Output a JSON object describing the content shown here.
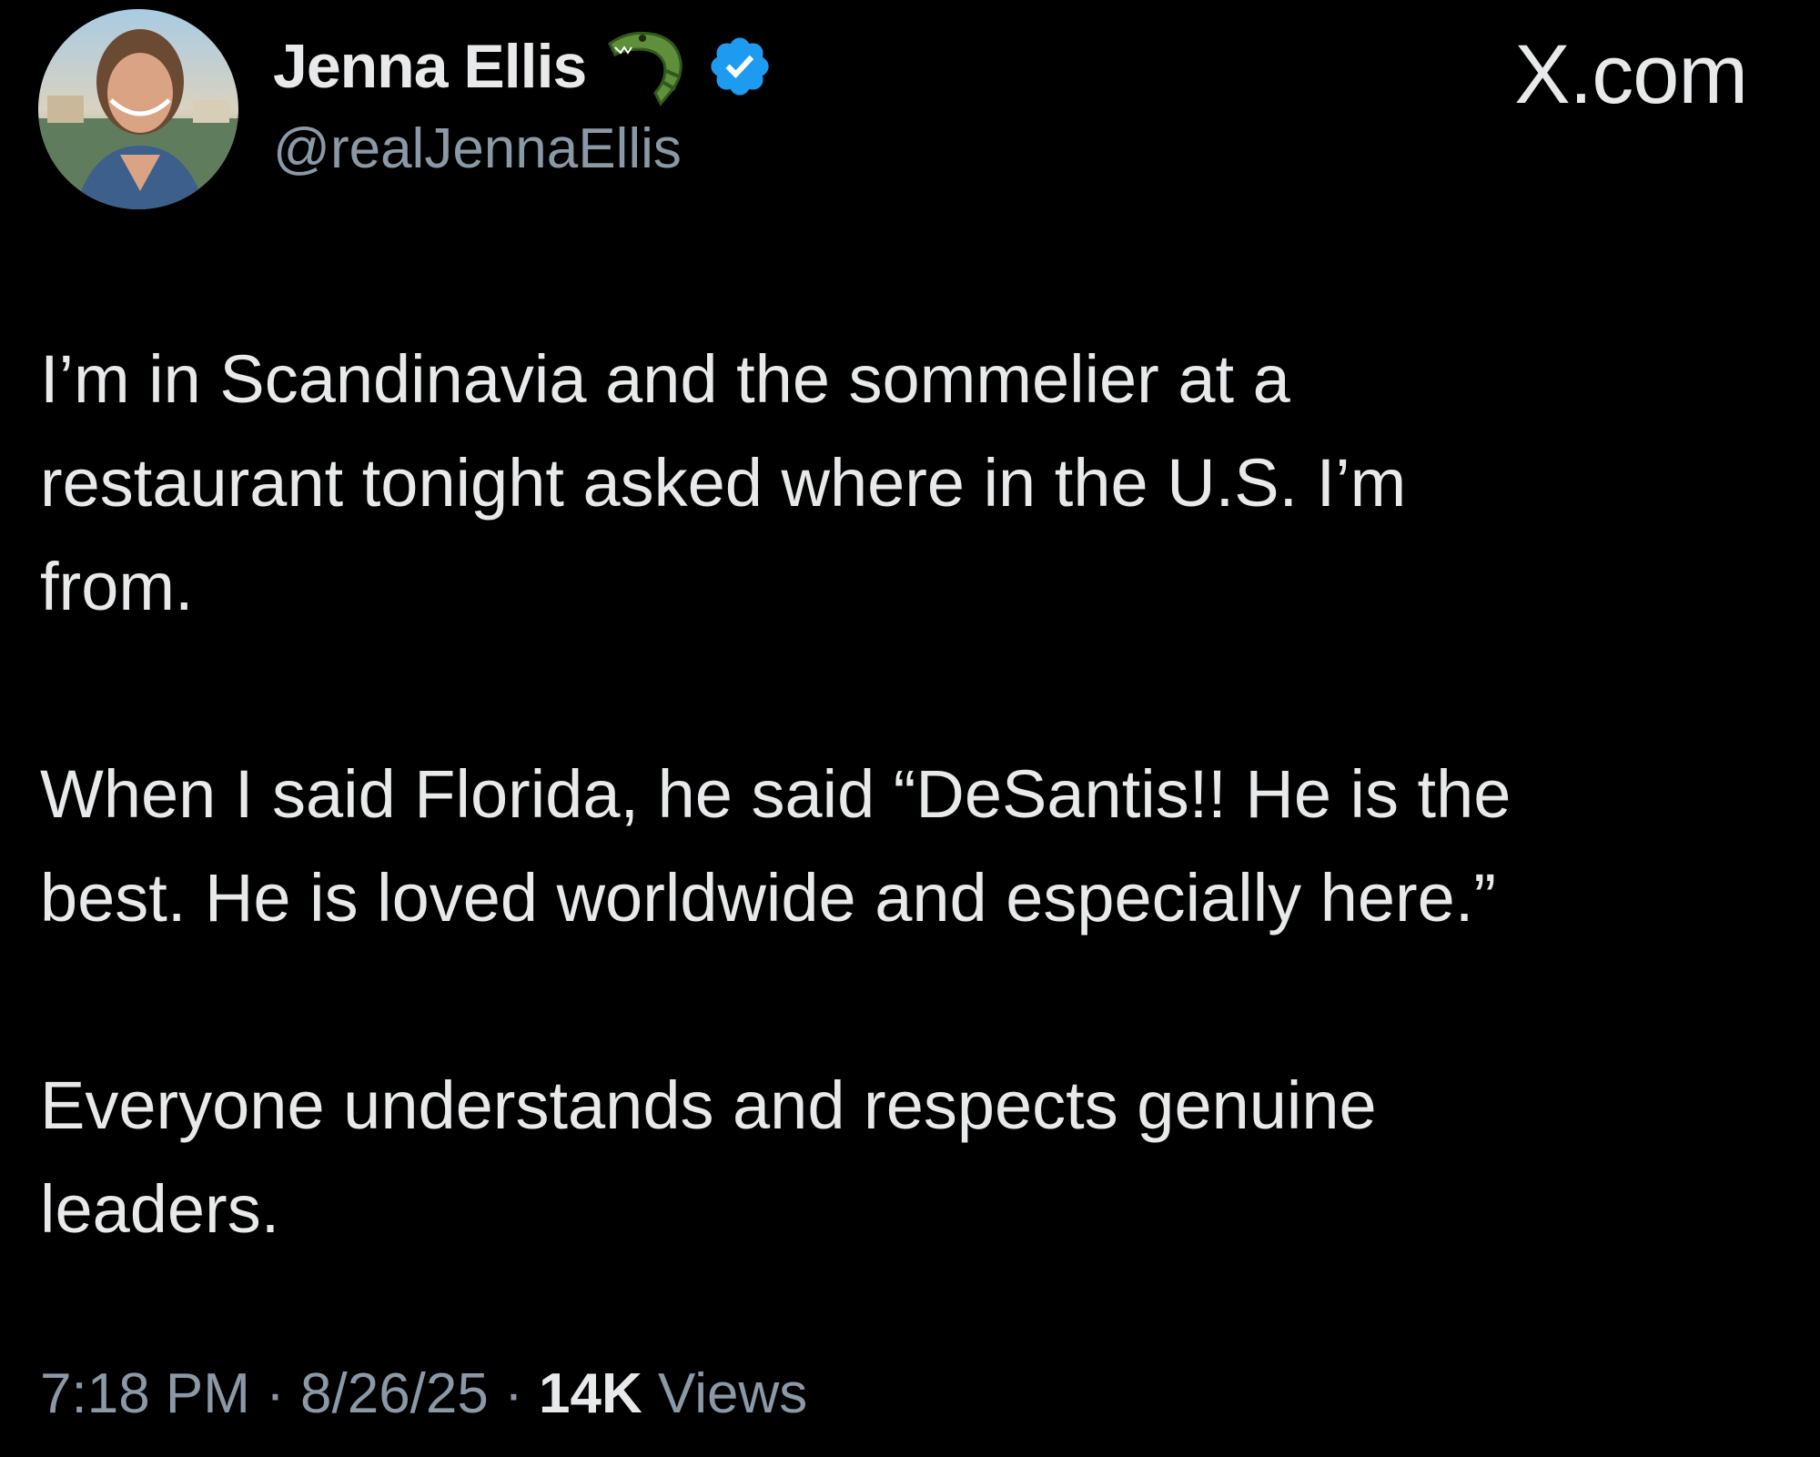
{
  "author": {
    "display_name": "Jenna Ellis",
    "handle": "@realJennaEllis",
    "name_emoji_icon": "alligator-icon",
    "verified_icon": "verified-badge-icon",
    "verified_color": "#1d9bf0"
  },
  "watermark": "X.com",
  "tweet": {
    "paragraphs": [
      "I’m in Scandinavia and the sommelier at a\nrestaurant tonight asked where in the U.S. I’m\nfrom.",
      "When I said Florida, he said “DeSantis!! He is the\nbest. He is loved worldwide and especially here.”",
      "Everyone understands and respects genuine\nleaders."
    ]
  },
  "meta": {
    "time": "7:18 PM",
    "separator": " · ",
    "date": "8/26/25",
    "views_count": "14K",
    "views_label": " Views"
  },
  "colors": {
    "background": "#000000",
    "text_primary": "#e7e9ea",
    "text_secondary": "#8b98a5",
    "accent": "#1d9bf0"
  }
}
